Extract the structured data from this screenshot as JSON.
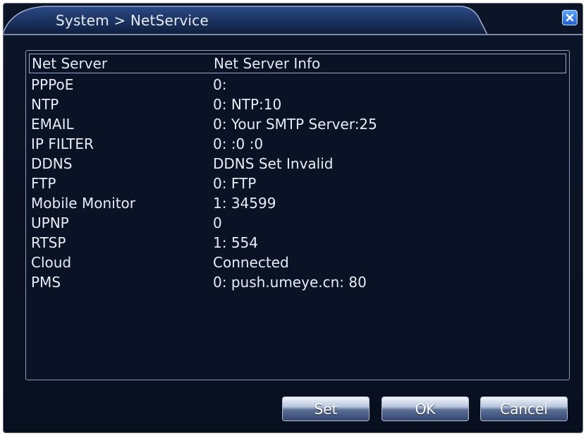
{
  "window": {
    "title": "System > NetService"
  },
  "table": {
    "headers": [
      "Net Server",
      "Net Server Info"
    ],
    "rows": [
      {
        "server": "PPPoE",
        "info": "0:"
      },
      {
        "server": "NTP",
        "info": "0: NTP:10"
      },
      {
        "server": "EMAIL",
        "info": "0: Your SMTP Server:25"
      },
      {
        "server": "IP FILTER",
        "info": "0: :0 :0"
      },
      {
        "server": "DDNS",
        "info": "DDNS Set Invalid"
      },
      {
        "server": "FTP",
        "info": "0: FTP"
      },
      {
        "server": "Mobile Monitor",
        "info": "1: 34599"
      },
      {
        "server": "UPNP",
        "info": "0"
      },
      {
        "server": "RTSP",
        "info": "1: 554"
      },
      {
        "server": "Cloud",
        "info": "Connected"
      },
      {
        "server": "PMS",
        "info": "0: push.umeye.cn: 80"
      }
    ]
  },
  "buttons": {
    "set": "Set",
    "ok": "OK",
    "cancel": "Cancel"
  },
  "icons": {
    "close": "close-icon"
  },
  "colors": {
    "background": "#0a1226",
    "text": "#e8edf5",
    "close_button": "#2f78e8"
  }
}
